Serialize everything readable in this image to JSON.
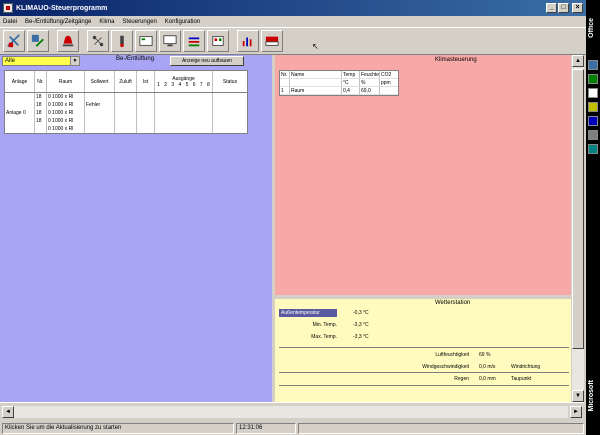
{
  "window": {
    "title": "KLIMAUO-Steuerprogramm",
    "controls": {
      "minimize": "_",
      "maximize": "□",
      "close": "×"
    }
  },
  "menu": {
    "items": [
      "Datei",
      "Be-/Entlüftung/Zeitgänge",
      "Klima",
      "Steuerungen",
      "Konfiguration"
    ]
  },
  "toolbar": {
    "buttons": [
      {
        "name": "ventilation-icon",
        "color": "#3a6ea5"
      },
      {
        "name": "ventilation-config-icon",
        "color": "#3a6ea5"
      },
      {
        "name": "alarm-icon",
        "color": "#c00000"
      },
      {
        "name": "network-icon",
        "color": "#404040"
      },
      {
        "name": "sensor-icon",
        "color": "#404040"
      },
      {
        "name": "controller-icon",
        "color": "#008000"
      },
      {
        "name": "display-icon",
        "color": "#404040"
      },
      {
        "name": "bar-chart-icon",
        "color": "#0000c0"
      },
      {
        "name": "schedule-icon",
        "color": "#c00000"
      },
      {
        "name": "report-icon",
        "color": "#c00000"
      },
      {
        "name": "exit-icon",
        "color": "#c00000"
      }
    ],
    "cursor_glyph": "↖"
  },
  "left_pane": {
    "combo_value": "Alle",
    "caption": "Be-/Entlüftung",
    "reload_label": "Anzeige neu aufbauen",
    "grid": {
      "headers": [
        "Anlage",
        "Nr.",
        "Raum",
        "Sollwert",
        "Zuluft",
        "Ist",
        "Ausgänge",
        "Status"
      ],
      "sub_headers": [
        "1",
        "2",
        "3",
        "4",
        "5",
        "6",
        "7",
        "8"
      ],
      "group": "Anlage 0",
      "rows": [
        {
          "nr": "18",
          "raum": "0 1000 x Rl",
          "soll": ""
        },
        {
          "nr": "18",
          "raum": "0 1000 x Rl",
          "soll": "Fehler"
        },
        {
          "nr": "18",
          "raum": "0 1000 x Rl",
          "soll": ""
        },
        {
          "nr": "18",
          "raum": "0 1000 x Rl",
          "soll": ""
        },
        {
          "nr": "",
          "raum": "0 1000 x Rl",
          "soll": ""
        }
      ]
    }
  },
  "pink_pane": {
    "caption": "Klimasteuerung",
    "table": {
      "headers": [
        "Nr.",
        "Name",
        "Temp",
        "Feuchte",
        "CO2"
      ],
      "units": [
        "",
        "",
        "°C",
        "%",
        "ppm"
      ],
      "row": [
        "1",
        "Raum",
        "0,4",
        "69,0",
        ""
      ]
    }
  },
  "yellow_pane": {
    "caption": "Wetterstation",
    "fields": [
      {
        "label": "Außentemperatur",
        "value": "-0,3 °C"
      },
      {
        "label": "Min. Temp.",
        "value": "-3,3 °C"
      },
      {
        "label": "Max. Temp.",
        "value": "-3,3 °C"
      }
    ],
    "metrics": [
      {
        "label": "Luftfeuchtigkeit",
        "value": "69 %",
        "extra": ""
      },
      {
        "label": "Windgeschwindigkeit",
        "value": "0,0 m/s",
        "extra": "Windrichtung"
      },
      {
        "label": "Regen",
        "value": "0,0 mm",
        "extra": "Taupunkt"
      }
    ]
  },
  "statusbar": {
    "message": "Klicken Sie um die Aktualisierung zu starten",
    "time": "12:31:06"
  }
}
